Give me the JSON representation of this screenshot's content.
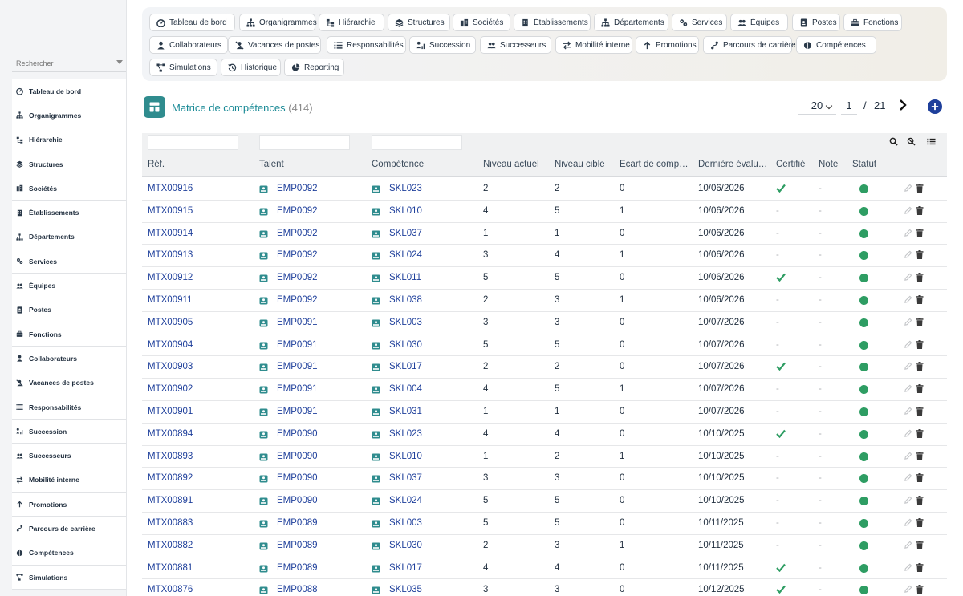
{
  "sidebar": {
    "search_placeholder": "Rechercher",
    "items": [
      {
        "label": "Tableau de bord",
        "icon": "dashboard-icon"
      },
      {
        "label": "Organigrammes",
        "icon": "sitemap-icon"
      },
      {
        "label": "Hiérarchie",
        "icon": "hierarchy-icon"
      },
      {
        "label": "Structures",
        "icon": "layers-icon"
      },
      {
        "label": "Sociétés",
        "icon": "buildings-icon"
      },
      {
        "label": "Établissements",
        "icon": "building-icon"
      },
      {
        "label": "Départements",
        "icon": "sitemap-icon"
      },
      {
        "label": "Services",
        "icon": "services-icon"
      },
      {
        "label": "Équipes",
        "icon": "users-icon"
      },
      {
        "label": "Postes",
        "icon": "id-badge-icon"
      },
      {
        "label": "Fonctions",
        "icon": "briefcase-icon"
      },
      {
        "label": "Collaborateurs",
        "icon": "user-tie-icon"
      },
      {
        "label": "Vacances de postes",
        "icon": "user-slash-icon"
      },
      {
        "label": "Responsabilités",
        "icon": "list-icon"
      },
      {
        "label": "Succession",
        "icon": "succession-icon"
      },
      {
        "label": "Successeurs",
        "icon": "users-icon"
      },
      {
        "label": "Mobilité interne",
        "icon": "exchange-icon"
      },
      {
        "label": "Promotions",
        "icon": "arrow-up-icon"
      },
      {
        "label": "Parcours de carrière",
        "icon": "route-icon"
      },
      {
        "label": "Compétences",
        "icon": "brain-icon"
      },
      {
        "label": "Simulations",
        "icon": "project-diagram-icon"
      }
    ]
  },
  "topnav": {
    "buttons": [
      {
        "label": "Tableau de bord",
        "icon": "dashboard-icon"
      },
      {
        "label": "Organigrammes",
        "icon": "sitemap-icon"
      },
      {
        "label": "Hiérarchie",
        "icon": "hierarchy-icon"
      },
      {
        "label": "Structures",
        "icon": "layers-icon"
      },
      {
        "label": "Sociétés",
        "icon": "buildings-icon"
      },
      {
        "label": "Établissements",
        "icon": "building-icon"
      },
      {
        "label": "Départements",
        "icon": "sitemap-icon"
      },
      {
        "label": "Services",
        "icon": "services-icon"
      },
      {
        "label": "Équipes",
        "icon": "users-icon"
      },
      {
        "label": "Postes",
        "icon": "id-badge-icon"
      },
      {
        "label": "Fonctions",
        "icon": "briefcase-icon"
      },
      {
        "label": "Collaborateurs",
        "icon": "user-tie-icon"
      },
      {
        "label": "Vacances de postes",
        "icon": "user-slash-icon"
      },
      {
        "label": "Responsabilités",
        "icon": "list-icon"
      },
      {
        "label": "Succession",
        "icon": "succession-icon"
      },
      {
        "label": "Successeurs",
        "icon": "users-icon"
      },
      {
        "label": "Mobilité interne",
        "icon": "exchange-icon"
      },
      {
        "label": "Promotions",
        "icon": "arrow-up-icon"
      },
      {
        "label": "Parcours de carrière",
        "icon": "route-icon"
      },
      {
        "label": "Compétences",
        "icon": "brain-icon"
      },
      {
        "label": "Simulations",
        "icon": "project-diagram-icon"
      },
      {
        "label": "Historique",
        "icon": "history-icon"
      },
      {
        "label": "Reporting",
        "icon": "pie-chart-icon"
      }
    ]
  },
  "page": {
    "title": "Matrice de compétences",
    "count": "(414)",
    "page_size": "20",
    "current_page": "1",
    "page_sep": "/",
    "total_pages": "21"
  },
  "table": {
    "columns": [
      "Réf.",
      "Talent",
      "Compétence",
      "Niveau actuel",
      "Niveau cible",
      "Écart de comp…",
      "Dernière évalu…",
      "Certifié",
      "Note",
      "Statut"
    ],
    "rows": [
      {
        "ref": "MTX00916",
        "talent": "EMP0092",
        "skill": "SKL023",
        "current": "2",
        "target": "2",
        "gap": "0",
        "date": "10/06/2026",
        "certified": true,
        "note": "-"
      },
      {
        "ref": "MTX00915",
        "talent": "EMP0092",
        "skill": "SKL010",
        "current": "4",
        "target": "5",
        "gap": "1",
        "date": "10/06/2026",
        "certified": false,
        "note": "-"
      },
      {
        "ref": "MTX00914",
        "talent": "EMP0092",
        "skill": "SKL037",
        "current": "1",
        "target": "1",
        "gap": "0",
        "date": "10/06/2026",
        "certified": false,
        "note": "-"
      },
      {
        "ref": "MTX00913",
        "talent": "EMP0092",
        "skill": "SKL024",
        "current": "3",
        "target": "4",
        "gap": "1",
        "date": "10/06/2026",
        "certified": false,
        "note": "-"
      },
      {
        "ref": "MTX00912",
        "talent": "EMP0092",
        "skill": "SKL011",
        "current": "5",
        "target": "5",
        "gap": "0",
        "date": "10/06/2026",
        "certified": true,
        "note": "-"
      },
      {
        "ref": "MTX00911",
        "talent": "EMP0092",
        "skill": "SKL038",
        "current": "2",
        "target": "3",
        "gap": "1",
        "date": "10/06/2026",
        "certified": false,
        "note": "-"
      },
      {
        "ref": "MTX00905",
        "talent": "EMP0091",
        "skill": "SKL003",
        "current": "3",
        "target": "3",
        "gap": "0",
        "date": "10/07/2026",
        "certified": false,
        "note": "-"
      },
      {
        "ref": "MTX00904",
        "talent": "EMP0091",
        "skill": "SKL030",
        "current": "5",
        "target": "5",
        "gap": "0",
        "date": "10/07/2026",
        "certified": false,
        "note": "-"
      },
      {
        "ref": "MTX00903",
        "talent": "EMP0091",
        "skill": "SKL017",
        "current": "2",
        "target": "2",
        "gap": "0",
        "date": "10/07/2026",
        "certified": true,
        "note": "-"
      },
      {
        "ref": "MTX00902",
        "talent": "EMP0091",
        "skill": "SKL004",
        "current": "4",
        "target": "5",
        "gap": "1",
        "date": "10/07/2026",
        "certified": false,
        "note": "-"
      },
      {
        "ref": "MTX00901",
        "talent": "EMP0091",
        "skill": "SKL031",
        "current": "1",
        "target": "1",
        "gap": "0",
        "date": "10/07/2026",
        "certified": false,
        "note": "-"
      },
      {
        "ref": "MTX00894",
        "talent": "EMP0090",
        "skill": "SKL023",
        "current": "4",
        "target": "4",
        "gap": "0",
        "date": "10/10/2025",
        "certified": true,
        "note": "-"
      },
      {
        "ref": "MTX00893",
        "talent": "EMP0090",
        "skill": "SKL010",
        "current": "1",
        "target": "2",
        "gap": "1",
        "date": "10/10/2025",
        "certified": false,
        "note": "-"
      },
      {
        "ref": "MTX00892",
        "talent": "EMP0090",
        "skill": "SKL037",
        "current": "3",
        "target": "3",
        "gap": "0",
        "date": "10/10/2025",
        "certified": false,
        "note": "-"
      },
      {
        "ref": "MTX00891",
        "talent": "EMP0090",
        "skill": "SKL024",
        "current": "5",
        "target": "5",
        "gap": "0",
        "date": "10/10/2025",
        "certified": false,
        "note": "-"
      },
      {
        "ref": "MTX00883",
        "talent": "EMP0089",
        "skill": "SKL003",
        "current": "5",
        "target": "5",
        "gap": "0",
        "date": "10/11/2025",
        "certified": false,
        "note": "-"
      },
      {
        "ref": "MTX00882",
        "talent": "EMP0089",
        "skill": "SKL030",
        "current": "2",
        "target": "3",
        "gap": "1",
        "date": "10/11/2025",
        "certified": false,
        "note": "-"
      },
      {
        "ref": "MTX00881",
        "talent": "EMP0089",
        "skill": "SKL017",
        "current": "4",
        "target": "4",
        "gap": "0",
        "date": "10/11/2025",
        "certified": true,
        "note": "-"
      },
      {
        "ref": "MTX00876",
        "talent": "EMP0088",
        "skill": "SKL035",
        "current": "3",
        "target": "3",
        "gap": "0",
        "date": "10/12/2025",
        "certified": true,
        "note": "-"
      }
    ]
  },
  "colors": {
    "accent": "#1a8a96",
    "link": "#1e3f9b",
    "status_ok": "#2e9d63",
    "check": "#2e9d63"
  }
}
